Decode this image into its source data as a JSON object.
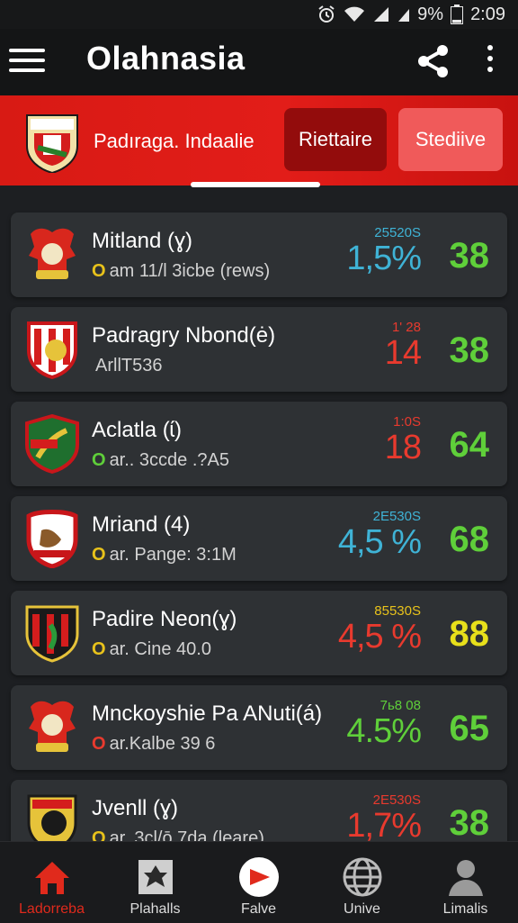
{
  "status_bar": {
    "battery": "9%",
    "time": "2:09"
  },
  "app_bar": {
    "title": "Olahnasia"
  },
  "header": {
    "subtitle": "Padıraga. Indaalie",
    "tabs": [
      "Riettaire",
      "Stediive"
    ]
  },
  "rows": [
    {
      "name": "Mitland (ɣ)",
      "sub_dot": "O",
      "sub_text": "am 11/l 3icbe (rews)",
      "small": "25520S",
      "big": "1,5%",
      "score": "38",
      "small_color": "#3fb3d6",
      "big_color": "#3fb3d6",
      "score_color": "#5fcf3a",
      "dot_color": "#e8c21b"
    },
    {
      "name": "Padragry Nbond(ė)",
      "sub_dot": "",
      "sub_text": "ArllT536",
      "small": "1' 28",
      "big": "14",
      "score": "38",
      "small_color": "#e83a2e",
      "big_color": "#e83a2e",
      "score_color": "#5fcf3a",
      "dot_color": "#e8c21b"
    },
    {
      "name": "Aclatla (ɩ́)",
      "sub_dot": "O",
      "sub_text": "ar.. 3ccde .?A5",
      "small": "1:0S",
      "big": "18",
      "score": "64",
      "small_color": "#e83a2e",
      "big_color": "#e83a2e",
      "score_color": "#5fcf3a",
      "dot_color": "#5fcf3a"
    },
    {
      "name": "Mriand (4)",
      "sub_dot": "O",
      "sub_text": "ar. Pange: 3:1M",
      "small": "2E530S",
      "big": "4,5 %",
      "score": "68",
      "small_color": "#3fb3d6",
      "big_color": "#3fb3d6",
      "score_color": "#5fcf3a",
      "dot_color": "#e8c21b"
    },
    {
      "name": "Padire Neon(ɣ)",
      "sub_dot": "O",
      "sub_text": "ar. Cine 40.0",
      "small": "85530S",
      "big": "4,5 %",
      "score": "88",
      "small_color": "#e8c21b",
      "big_color": "#e83a2e",
      "score_color": "#e8e01b",
      "dot_color": "#e8c21b"
    },
    {
      "name": "Mnckoyshie Pa ANuti(á)",
      "sub_dot": "O",
      "sub_text": "ar.Kalbe 39 6",
      "small": "7ь8 08",
      "big": "4.5%",
      "score": "65",
      "small_color": "#5fcf3a",
      "big_color": "#5fcf3a",
      "score_color": "#5fcf3a",
      "dot_color": "#e83a2e"
    },
    {
      "name": "Jvenll (ɣ)",
      "sub_dot": "O",
      "sub_text": "ar. 3cl/ō 7da (leare)",
      "small": "2E530S",
      "big": "1,7%",
      "score": "38",
      "small_color": "#e83a2e",
      "big_color": "#e83a2e",
      "score_color": "#5fcf3a",
      "dot_color": "#e8c21b"
    }
  ],
  "nav": [
    {
      "label": "Ladorreba",
      "icon": "home-icon",
      "color": "#e02a1c"
    },
    {
      "label": "Plahalls",
      "icon": "players-icon",
      "color": "#ddd"
    },
    {
      "label": "Falve",
      "icon": "play-icon",
      "color": "#ddd"
    },
    {
      "label": "Unive",
      "icon": "globe-icon",
      "color": "#ddd"
    },
    {
      "label": "Limalis",
      "icon": "profile-icon",
      "color": "#ddd"
    }
  ],
  "colors": {
    "accent_red": "#e21d19",
    "card_bg": "#2e3134",
    "page_bg": "#1d1f22"
  }
}
